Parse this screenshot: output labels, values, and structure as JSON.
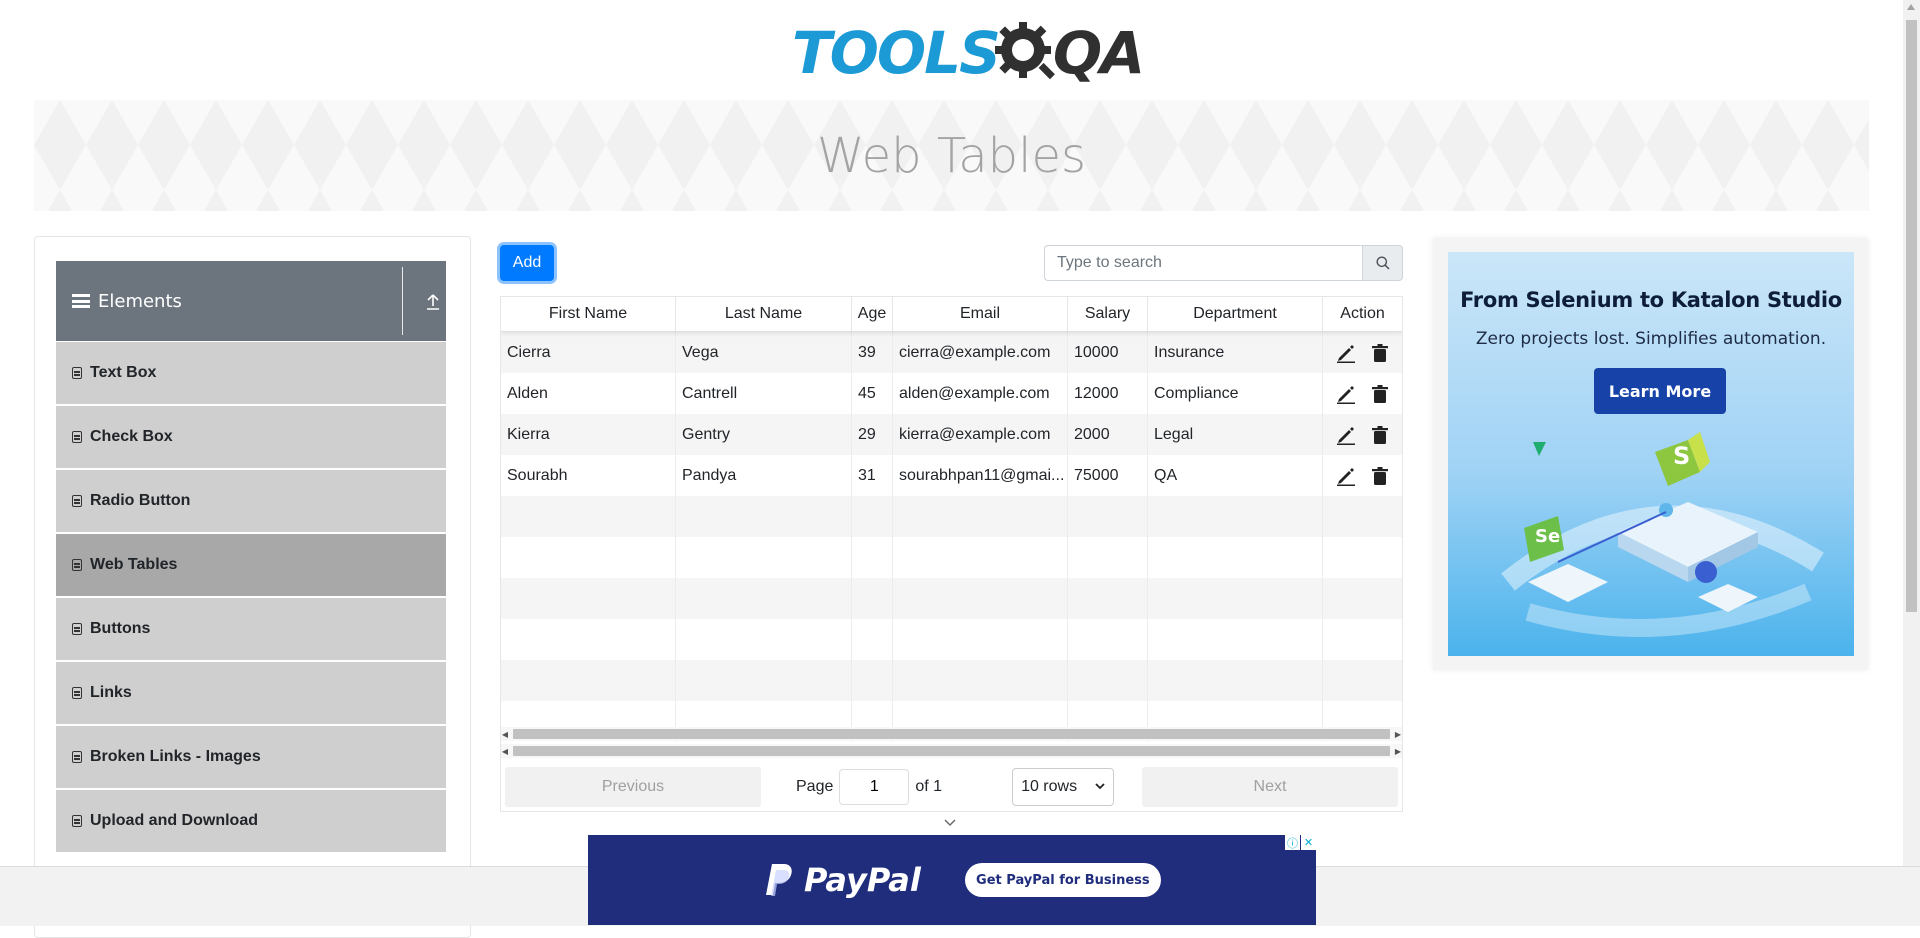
{
  "brand": {
    "logo_tools": "TOOLS",
    "logo_qa": "QA"
  },
  "banner": {
    "title": "Web Tables"
  },
  "sidebar": {
    "group_title": "Elements",
    "items": [
      {
        "label": "Text Box",
        "active": false
      },
      {
        "label": "Check Box",
        "active": false
      },
      {
        "label": "Radio Button",
        "active": false
      },
      {
        "label": "Web Tables",
        "active": true
      },
      {
        "label": "Buttons",
        "active": false
      },
      {
        "label": "Links",
        "active": false
      },
      {
        "label": "Broken Links - Images",
        "active": false
      },
      {
        "label": "Upload and Download",
        "active": false
      }
    ]
  },
  "toolbar": {
    "add_label": "Add"
  },
  "search": {
    "placeholder": "Type to search",
    "value": ""
  },
  "table": {
    "headers": [
      "First Name",
      "Last Name",
      "Age",
      "Email",
      "Salary",
      "Department",
      "Action"
    ],
    "rows": [
      [
        "Cierra",
        "Vega",
        "39",
        "cierra@example.com",
        "10000",
        "Insurance"
      ],
      [
        "Alden",
        "Cantrell",
        "45",
        "alden@example.com",
        "12000",
        "Compliance"
      ],
      [
        "Kierra",
        "Gentry",
        "29",
        "kierra@example.com",
        "2000",
        "Legal"
      ],
      [
        "Sourabh",
        "Pandya",
        "31",
        "sourabhpan11@gmai...",
        "75000",
        "QA"
      ]
    ],
    "empty_rows": 6
  },
  "pagination": {
    "previous": "Previous",
    "next": "Next",
    "page_label": "Page",
    "page_value": "1",
    "of_label": "of 1",
    "rows_option": "10 rows"
  },
  "ad_right": {
    "title": "From Selenium to Katalon Studio",
    "subtitle": "Zero projects lost. Simplifies automation.",
    "button": "Learn More",
    "badge_s": "S",
    "badge_se": "Se"
  },
  "ad_bottom": {
    "brand": "PayPal",
    "button": "Get PayPal for Business"
  },
  "colors": {
    "primary": "#007bff",
    "sidebar_header": "#6c757d",
    "sidebar_item": "#cfcfcf",
    "sidebar_item_active": "#a8a8a8",
    "logo_blue": "#1c9ad6",
    "paypal_navy": "#1f2d7c"
  }
}
